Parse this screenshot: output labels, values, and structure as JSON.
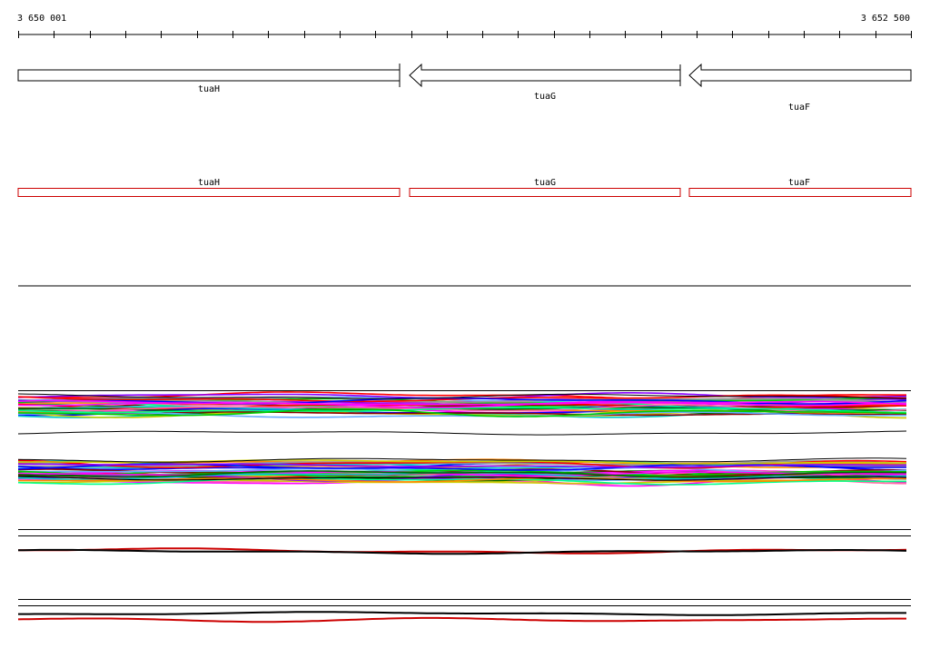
{
  "ruler": {
    "start_label": "3 650 001",
    "end_label": "3 652 500",
    "start": 3650001,
    "end": 3652500,
    "tick_count": 26
  },
  "genes": [
    {
      "name": "tuaH",
      "strand": "+"
    },
    {
      "name": "tuaG",
      "strand": "-"
    },
    {
      "name": "tuaF",
      "strand": "-"
    }
  ],
  "colors": {
    "background": "#ffffff",
    "axis": "#000000",
    "gene_outline": "#000000",
    "cds_outline": "#cc0000",
    "profile_primary": "#000000",
    "profile_secondary": "#cc0000",
    "profile_palette": [
      "#ff0000",
      "#00cc00",
      "#0000ff",
      "#ff00ff",
      "#00cccc",
      "#cccc00",
      "#ff8800",
      "#8800ff",
      "#006600",
      "#880000",
      "#ff66aa",
      "#66aaff",
      "#999999",
      "#00ff88"
    ]
  }
}
